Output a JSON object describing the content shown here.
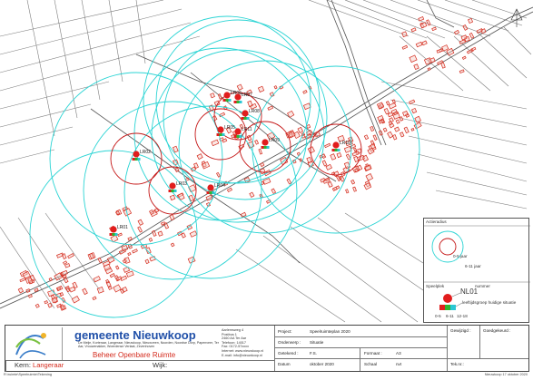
{
  "map": {
    "play_areas": [
      {
        "code": "LR01"
      },
      {
        "code": "LR02"
      },
      {
        "code": "LR03"
      },
      {
        "code": "LR04"
      },
      {
        "code": "LR05"
      },
      {
        "code": "LR06"
      },
      {
        "code": "LR07"
      },
      {
        "code": "LR08"
      },
      {
        "code": "LR09"
      },
      {
        "code": "LR10"
      },
      {
        "code": "LR11"
      }
    ]
  },
  "legend": {
    "title": "Actieradius",
    "age_0_5": "0-5 jaar",
    "age_6_11": "6-11 jaar",
    "speelplek": "Speelplek",
    "nummer": "nummer",
    "code": "NL01",
    "groups_label": "leeftijdsgroep huidige situatie",
    "g1": "0-5",
    "g2": "6-11",
    "g3": "12-18",
    "colors": {
      "age_0_5": "#d42a1c",
      "age_6_11": "#2bd4d4",
      "g1": "#e11d1d",
      "g2": "#2fb52f",
      "g3": "#2bc7d4"
    }
  },
  "titleblock": {
    "org": "gemeente Nieuwkoop",
    "villages": "De Meije, Korteraar, Langeraar, Nieuwkoop, Nieuwveen, Noorden, Noordse Dorp, Papenveer, Ter Aar, Vrouwenakker, Woerdense Verlaat, Zevenhoven",
    "department": "Beheer Openbare Ruimte",
    "contact": [
      "Aarlemsweg 4",
      "Postbus 1",
      "2460 AA Ter Aar",
      "Telefoon: 14017",
      "Fax: 0172-57xxxx",
      "Internet: www.nieuwkoop.nl",
      "E-mail: info@nieuwkoop.nl"
    ],
    "kern_label": "Kern:",
    "kern_value": "Langeraar",
    "wijk_label": "Wijk:",
    "project_label": "Project:",
    "project_value": "Speelruimteplan 2020",
    "onderwerp_label": "Onderwerp :",
    "onderwerp_value": "Situatie",
    "getekend_label": "Getekend :",
    "getekend_value": "F.S.",
    "datum_label": "Datum",
    "datum_value": "oktober 2020",
    "formaat_label": "Formaat :",
    "formaat_value": "A3",
    "schaal_label": "Schaal",
    "schaal_value": "nvt",
    "gewijzigd_label": "Gewijzigd :",
    "goedgekeurd_label": "Goedgekeurd :",
    "teknr_label": "Tek.nr.:",
    "footer_left": "R:\\ruimte\\Speelruimte\\Tekening",
    "footer_right": "Nieuwkoop 17 oktober 2020"
  }
}
